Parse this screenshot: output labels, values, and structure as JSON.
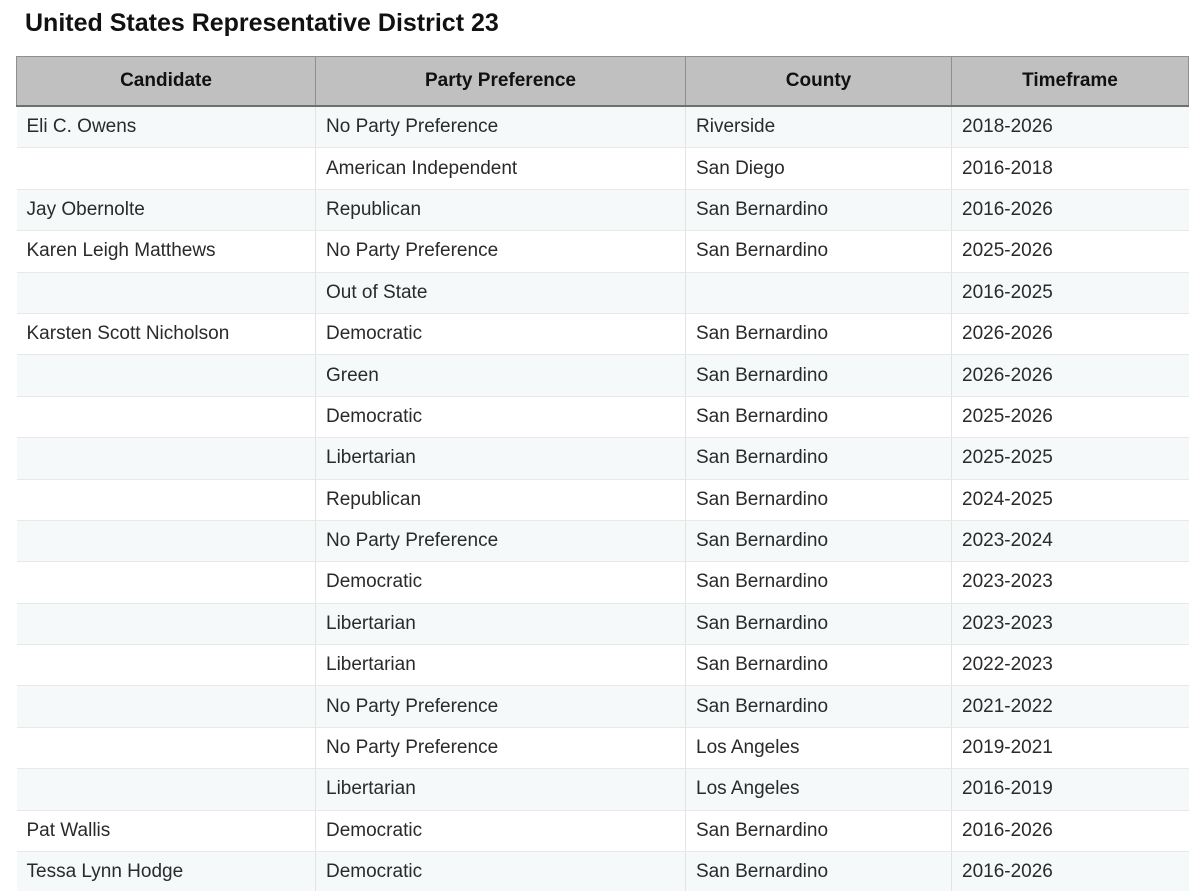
{
  "page": {
    "title": "United States Representative District 23"
  },
  "table": {
    "headers": [
      "Candidate",
      "Party Preference",
      "County",
      "Timeframe"
    ],
    "rows": [
      {
        "candidate": "Eli C. Owens",
        "party": "No Party Preference",
        "county": "Riverside",
        "timeframe": "2018-2026"
      },
      {
        "candidate": "",
        "party": "American Independent",
        "county": "San Diego",
        "timeframe": "2016-2018"
      },
      {
        "candidate": "Jay Obernolte",
        "party": "Republican",
        "county": "San Bernardino",
        "timeframe": "2016-2026"
      },
      {
        "candidate": "Karen Leigh Matthews",
        "party": "No Party Preference",
        "county": "San Bernardino",
        "timeframe": "2025-2026"
      },
      {
        "candidate": "",
        "party": "Out of State",
        "county": "",
        "timeframe": "2016-2025"
      },
      {
        "candidate": "Karsten Scott Nicholson",
        "party": "Democratic",
        "county": "San Bernardino",
        "timeframe": "2026-2026"
      },
      {
        "candidate": "",
        "party": "Green",
        "county": "San Bernardino",
        "timeframe": "2026-2026"
      },
      {
        "candidate": "",
        "party": "Democratic",
        "county": "San Bernardino",
        "timeframe": "2025-2026"
      },
      {
        "candidate": "",
        "party": "Libertarian",
        "county": "San Bernardino",
        "timeframe": "2025-2025"
      },
      {
        "candidate": "",
        "party": "Republican",
        "county": "San Bernardino",
        "timeframe": "2024-2025"
      },
      {
        "candidate": "",
        "party": "No Party Preference",
        "county": "San Bernardino",
        "timeframe": "2023-2024"
      },
      {
        "candidate": "",
        "party": "Democratic",
        "county": "San Bernardino",
        "timeframe": "2023-2023"
      },
      {
        "candidate": "",
        "party": "Libertarian",
        "county": "San Bernardino",
        "timeframe": "2023-2023"
      },
      {
        "candidate": "",
        "party": "Libertarian",
        "county": "San Bernardino",
        "timeframe": "2022-2023"
      },
      {
        "candidate": "",
        "party": "No Party Preference",
        "county": "San Bernardino",
        "timeframe": "2021-2022"
      },
      {
        "candidate": "",
        "party": "No Party Preference",
        "county": "Los Angeles",
        "timeframe": "2019-2021"
      },
      {
        "candidate": "",
        "party": "Libertarian",
        "county": "Los Angeles",
        "timeframe": "2016-2019"
      },
      {
        "candidate": "Pat Wallis",
        "party": "Democratic",
        "county": "San Bernardino",
        "timeframe": "2016-2026"
      },
      {
        "candidate": "Tessa Lynn Hodge",
        "party": "Democratic",
        "county": "San Bernardino",
        "timeframe": "2016-2026"
      }
    ]
  }
}
